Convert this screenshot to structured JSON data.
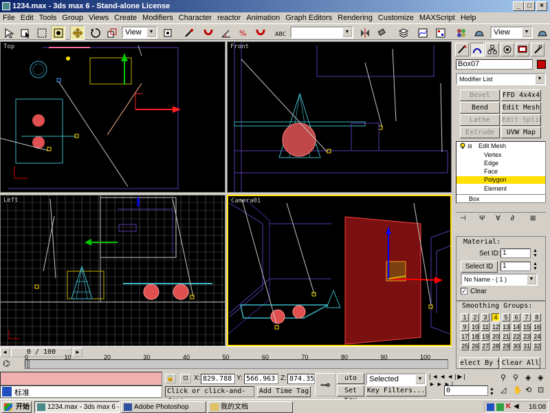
{
  "window": {
    "title": "1234.max - 3ds max 6 - Stand-alone License",
    "btn_min": "_",
    "btn_max": "□",
    "btn_close": "×"
  },
  "menu": [
    "File",
    "Edit",
    "Tools",
    "Group",
    "Views",
    "Create",
    "Modifiers",
    "Character",
    "reactor",
    "Animation",
    "Graph Editors",
    "Rendering",
    "Customize",
    "MAXScript",
    "Help"
  ],
  "toolbar": {
    "ref_coord": "View",
    "selection_set": "",
    "ref_coord2": "View"
  },
  "viewports": {
    "top": "Top",
    "front": "Front",
    "left": "Left",
    "camera": "Camera01"
  },
  "panel": {
    "object_name": "Box07",
    "object_color": "#c00000",
    "modifier_list": "Modifier List",
    "modifier_buttons": [
      {
        "label": "Bevel",
        "enabled": false
      },
      {
        "label": "FFD 4x4x4",
        "enabled": true
      },
      {
        "label": "Bend",
        "enabled": true
      },
      {
        "label": "Edit Mesh",
        "enabled": true
      },
      {
        "label": "Lathe",
        "enabled": false
      },
      {
        "label": "Edit Spline",
        "enabled": false
      },
      {
        "label": "Extrude",
        "enabled": false
      },
      {
        "label": "UVW Map",
        "enabled": true
      }
    ],
    "stack": {
      "modifier": "Edit Mesh",
      "subobjects": [
        "Vertex",
        "Edge",
        "Face",
        "Polygon",
        "Element"
      ],
      "selected": "Polygon",
      "base": "Box"
    },
    "material": {
      "rollout_title": "Material:",
      "set_id_label": "Set ID:",
      "set_id_value": "1",
      "select_id_label": "Select ID",
      "select_id_value": "1",
      "name_dropdown": "No Name - ( 1 )",
      "clear_label": "Clear",
      "clear_checked": true
    },
    "smoothing": {
      "title": "Smoothing Groups:",
      "groups": [
        "1",
        "2",
        "3",
        "4",
        "5",
        "6",
        "7",
        "8",
        "9",
        "10",
        "11",
        "12",
        "13",
        "14",
        "15",
        "16",
        "17",
        "18",
        "19",
        "20",
        "21",
        "22",
        "23",
        "24",
        "25",
        "26",
        "27",
        "28",
        "29",
        "30",
        "31",
        "32"
      ],
      "active": "4",
      "select_by": "elect By S",
      "clear_all": "Clear All"
    }
  },
  "timeline": {
    "frame_display": "0 / 100",
    "ticks": [
      "0",
      "10",
      "20",
      "30",
      "40",
      "50",
      "60",
      "70",
      "80",
      "90",
      "100"
    ]
  },
  "status": {
    "prompt": "Click or click-and-drag",
    "add_time_tag": "Add Time Tag",
    "lang": "标准",
    "x_label": "X:",
    "x": "829.788",
    "y_label": "Y:",
    "y": "566.963",
    "z_label": "Z:",
    "z": "874.35",
    "auto_key": "uto Key",
    "set_key": "Set Key",
    "key_mode": "Selected",
    "key_filters": "Key Filters...",
    "frame": "0"
  },
  "taskbar": {
    "start": "开始",
    "tasks": [
      {
        "label": "1234.max - 3ds max 6 - ...",
        "active": true
      },
      {
        "label": "Adobe Photoshop",
        "active": false
      },
      {
        "label": "我的文档",
        "active": false
      }
    ],
    "clock": "16:08"
  }
}
